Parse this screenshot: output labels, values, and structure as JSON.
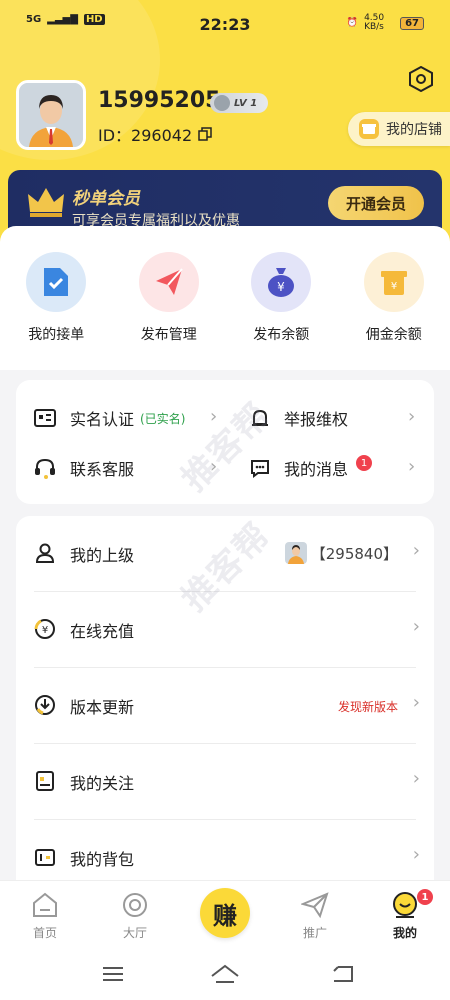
{
  "status_bar": {
    "signal_left": "5G",
    "hd": "HD",
    "time": "22:23",
    "speed": "4.50 KB/s",
    "battery": "67"
  },
  "profile": {
    "name": "15995205",
    "level": "LV 1",
    "id_label": "ID：296042",
    "shop_label": "我的店铺"
  },
  "vip": {
    "title": "秒单会员",
    "subtitle": "可享会员专属福利以及优惠",
    "button": "开通会员"
  },
  "quick_actions": [
    {
      "label": "我的接单",
      "icon": "document-check-icon",
      "bg": "#dbe9f8",
      "fg": "#3a86e0"
    },
    {
      "label": "发布管理",
      "icon": "paper-plane-icon",
      "bg": "#fde5e6",
      "fg": "#f2585e"
    },
    {
      "label": "发布余额",
      "icon": "money-bag-icon",
      "bg": "#e3e4f8",
      "fg": "#4d52c4"
    },
    {
      "label": "佣金余额",
      "icon": "wallet-icon",
      "bg": "#fdf0d6",
      "fg": "#f5b93a"
    }
  ],
  "grid_menu": {
    "real_name": "实名认证",
    "real_name_status": "(已实名)",
    "report": "举报维权",
    "support": "联系客服",
    "messages": "我的消息",
    "messages_badge": "1"
  },
  "list": {
    "superior": "我的上级",
    "superior_value": "【295840】",
    "recharge": "在线充值",
    "update": "版本更新",
    "update_value": "发现新版本",
    "follow": "我的关注",
    "backpack": "我的背包"
  },
  "watermark": "推客帮",
  "tabs": {
    "home": "首页",
    "hall": "大厅",
    "earn": "赚",
    "promote": "推广",
    "mine": "我的",
    "mine_badge": "1"
  },
  "colors": {
    "accent_yellow": "#fbdf45",
    "vip_bg": "#1f2d63",
    "badge_red": "#f0414d",
    "update_red": "#d9302a"
  }
}
